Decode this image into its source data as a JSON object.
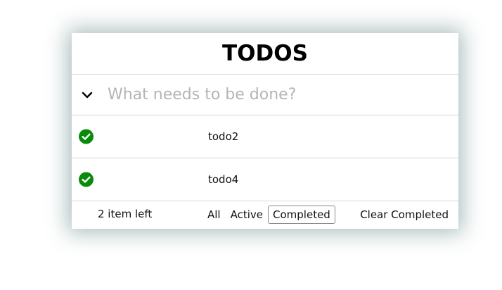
{
  "app": {
    "title": "TODOS"
  },
  "new_todo": {
    "placeholder": "What needs to be done?",
    "value": ""
  },
  "todos": [
    {
      "label": "todo2",
      "completed": true
    },
    {
      "label": "todo4",
      "completed": true
    }
  ],
  "footer": {
    "count_text": "2 item left",
    "filters": [
      {
        "label": "All",
        "selected": false
      },
      {
        "label": "Active",
        "selected": false
      },
      {
        "label": "Completed",
        "selected": true
      }
    ],
    "clear_label": "Clear Completed"
  },
  "colors": {
    "check_green": "#0a8a0a",
    "border": "#d6d6d6",
    "placeholder": "#b5b5b5",
    "shadow": "#466e6e"
  },
  "icons": {
    "toggle_all": "chevron-down-icon",
    "completed": "check-circle-icon"
  }
}
